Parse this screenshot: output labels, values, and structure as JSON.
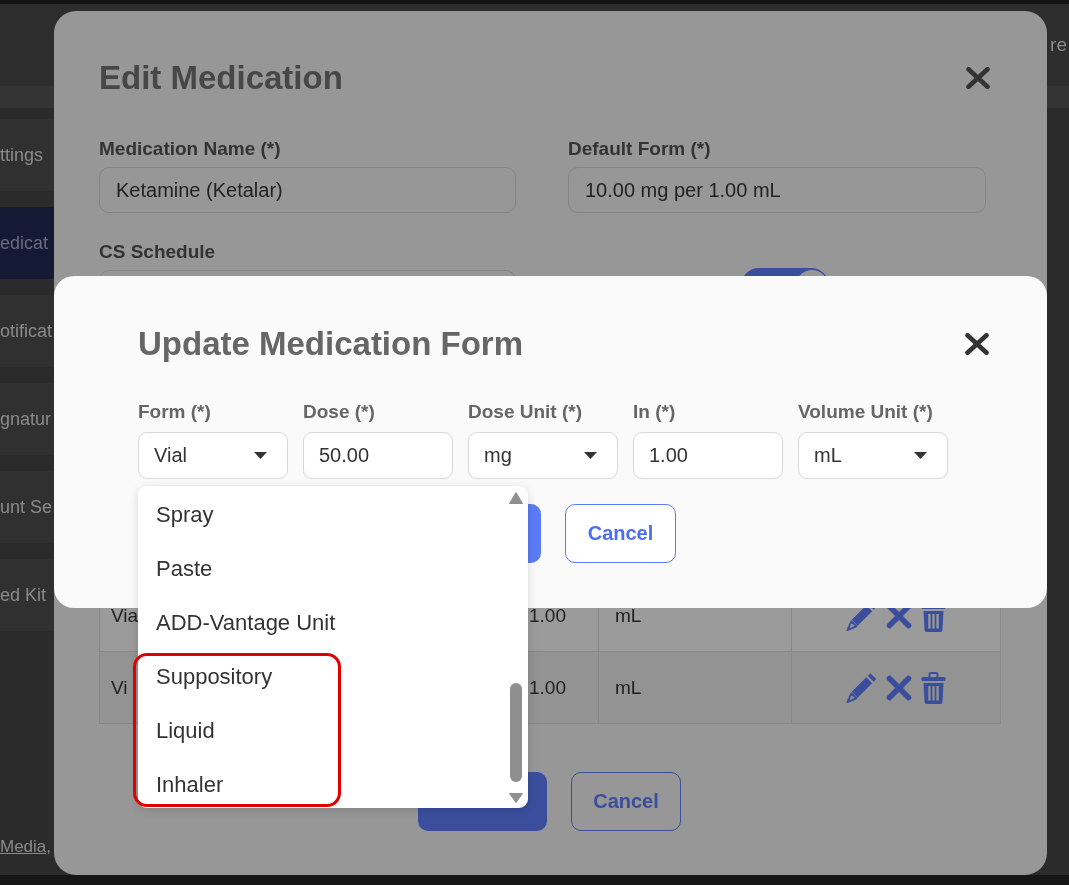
{
  "background_app": {
    "header": {
      "text": "re"
    },
    "sidebar": {
      "items": [
        {
          "label": "ttings",
          "selected": false
        },
        {
          "label": "edicat",
          "selected": true
        },
        {
          "label": "otificat",
          "selected": false
        },
        {
          "label": "gnatur",
          "selected": false
        },
        {
          "label": "unt Se",
          "selected": false
        },
        {
          "label": "ed Kit",
          "selected": false
        }
      ]
    },
    "footer": {
      "link": "Media,"
    }
  },
  "edit_dialog": {
    "title": "Edit Medication",
    "fields": [
      {
        "label": "Medication Name (*)",
        "value": "Ketamine (Ketalar)"
      },
      {
        "label": "Default Form (*)",
        "value": "10.00 mg per 1.00 mL"
      },
      {
        "label": "CS Schedule"
      }
    ],
    "toggle": {
      "on": true
    },
    "table": {
      "rows": [
        {
          "cells": [
            "Via",
            "1.00",
            "mL"
          ]
        },
        {
          "cells": [
            "Vi",
            "1.00",
            "mL"
          ]
        }
      ]
    },
    "buttons": [
      {
        "kind": "primary"
      },
      {
        "kind": "secondary",
        "label": "Cancel"
      }
    ]
  },
  "update_dialog": {
    "title": "Update Medication Form",
    "fields": [
      {
        "label": "Form (*)",
        "kind": "select",
        "value": "Vial",
        "options": [
          {
            "label": "Spray",
            "annotated": false
          },
          {
            "label": "Paste",
            "annotated": false
          },
          {
            "label": "ADD-Vantage Unit",
            "annotated": false
          },
          {
            "label": "Suppository",
            "annotated": true
          },
          {
            "label": "Liquid",
            "annotated": true
          },
          {
            "label": "Inhaler",
            "annotated": true
          }
        ]
      },
      {
        "label": "Dose (*)",
        "kind": "input",
        "value": "50.00"
      },
      {
        "label": "Dose Unit (*)",
        "kind": "select",
        "value": "mg"
      },
      {
        "label": "In (*)",
        "kind": "input",
        "value": "1.00"
      },
      {
        "label": "Volume Unit (*)",
        "kind": "select",
        "value": "mL"
      }
    ],
    "buttons": [
      {
        "kind": "primary"
      },
      {
        "kind": "secondary",
        "label": "Cancel"
      }
    ]
  }
}
